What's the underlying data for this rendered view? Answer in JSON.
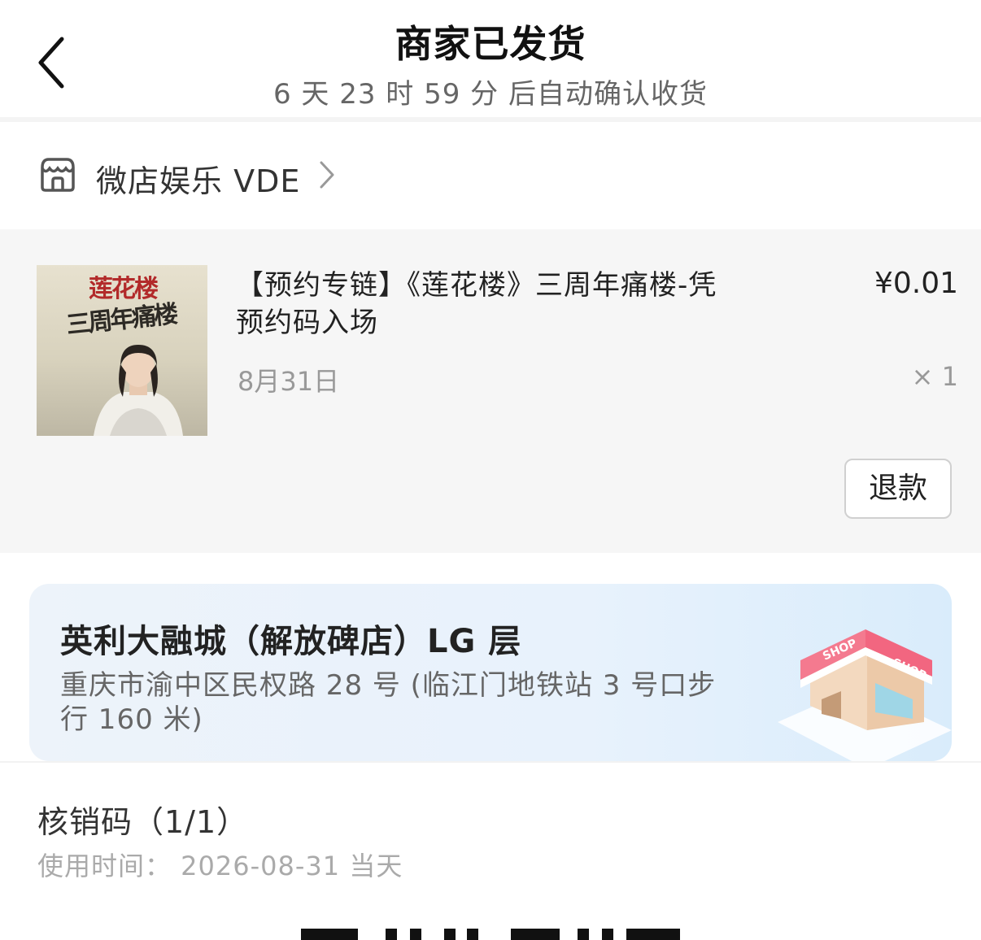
{
  "header": {
    "title": "商家已发货",
    "subtitle": "6 天 23 时 59 分  后自动确认收货"
  },
  "store": {
    "name": "微店娱乐 VDE",
    "icon": "store-icon"
  },
  "product": {
    "title": "【预约专链】《莲花楼》三周年痛楼-凭预约码入场",
    "price": "¥0.01",
    "date": "8月31日",
    "quantity": "× 1",
    "refund_label": "退款",
    "thumb_text_1": "莲花楼",
    "thumb_text_2": "三周年痛楼"
  },
  "location": {
    "name": "英利大融城（解放碑店）LG 层",
    "address": "重庆市渝中区民权路 28 号 (临江门地铁站 3 号口步行 160 米)",
    "shop_sign": "SHOP"
  },
  "verification": {
    "title": "核销码（1/1）",
    "usage_time": "使用时间： 2026-08-31 当天"
  }
}
